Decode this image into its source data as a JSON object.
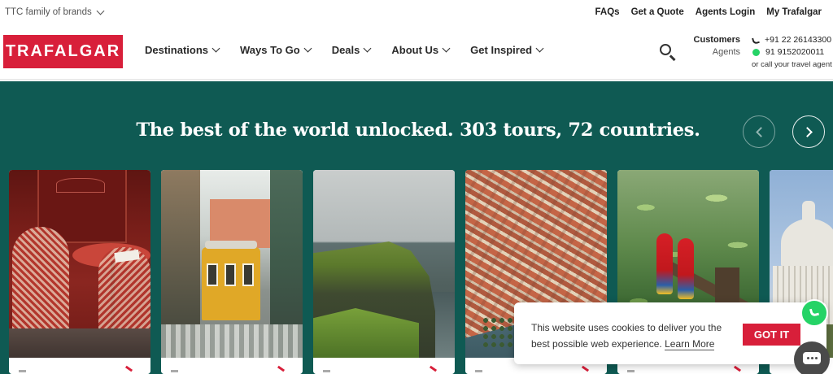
{
  "utility": {
    "family_label": "TTC family of brands",
    "links": [
      "FAQs",
      "Get a Quote",
      "Agents Login",
      "My Trafalgar"
    ]
  },
  "nav": {
    "logo_text": "TRAFALGAR",
    "items": [
      "Destinations",
      "Ways To Go",
      "Deals",
      "About Us",
      "Get Inspired"
    ],
    "customers_label": "Customers",
    "agents_label": "Agents",
    "phone_customers": "+91 22 26143300",
    "phone_whatsapp": "91 9152020011",
    "call_agent_note": "or call your travel agent"
  },
  "hero": {
    "title": "The best of the world unlocked. 303 tours, 72 countries."
  },
  "cookie": {
    "message": "This website uses cookies to deliver you the best possible web experience.",
    "learn_more": "Learn More",
    "accept": "GOT IT"
  },
  "colors": {
    "brand_red": "#d81f3a",
    "hero_green": "#0f5a53",
    "whatsapp_green": "#25d366"
  },
  "icons": {
    "search": "search-icon",
    "phone": "phone-icon",
    "whatsapp": "whatsapp-icon",
    "chat": "chat-icon"
  }
}
